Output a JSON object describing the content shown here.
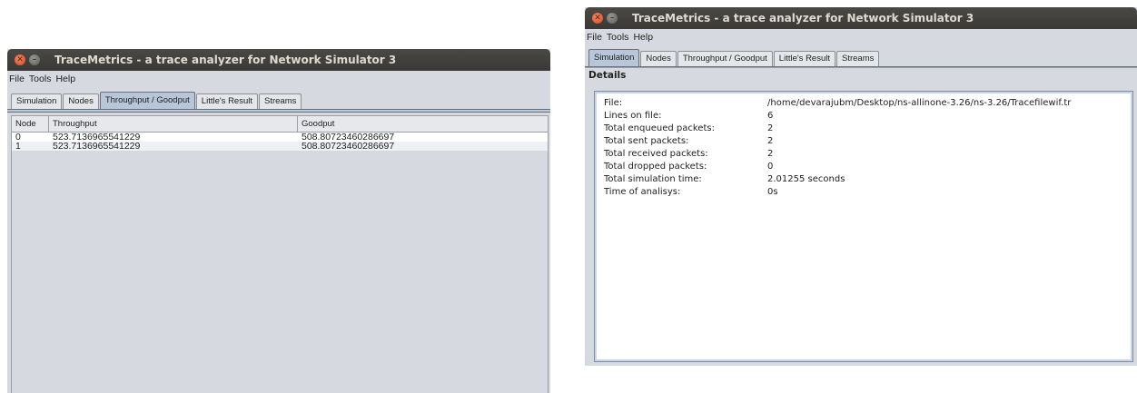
{
  "left_window": {
    "title": "TraceMetrics - a trace analyzer for Network Simulator 3",
    "menu": [
      "File",
      "Tools",
      "Help"
    ],
    "tabs": [
      "Simulation",
      "Nodes",
      "Throughput / Goodput",
      "Little's Result",
      "Streams"
    ],
    "active_tab": "Throughput / Goodput",
    "table": {
      "columns": [
        "Node",
        "Throughput",
        "Goodput"
      ],
      "rows": [
        [
          "0",
          "523.7136965541229",
          "508.80723460286697"
        ],
        [
          "1",
          "523.7136965541229",
          "508.80723460286697"
        ]
      ]
    }
  },
  "right_window": {
    "title": "TraceMetrics - a trace analyzer for Network Simulator 3",
    "menu": [
      "File",
      "Tools",
      "Help"
    ],
    "tabs": [
      "Simulation",
      "Nodes",
      "Throughput / Goodput",
      "Little's Result",
      "Streams"
    ],
    "active_tab": "Simulation",
    "details_label": "Details",
    "details": [
      {
        "key": "File:",
        "value": "/home/devarajubm/Desktop/ns-allinone-3.26/ns-3.26/Tracefilewif.tr"
      },
      {
        "key": "Lines on file:",
        "value": "6"
      },
      {
        "key": "Total enqueued packets:",
        "value": "2"
      },
      {
        "key": "Total sent packets:",
        "value": "2"
      },
      {
        "key": "Total received packets:",
        "value": "2"
      },
      {
        "key": "Total dropped packets:",
        "value": "0"
      },
      {
        "key": "Total simulation time:",
        "value": "2.01255 seconds"
      },
      {
        "key": "Time of analisys:",
        "value": "0s"
      }
    ]
  },
  "colors": {
    "titlebar": "#3c3b37",
    "close_button": "#e4572e",
    "active_tab": "#b8c6da",
    "window_bg": "#d6d9df"
  }
}
